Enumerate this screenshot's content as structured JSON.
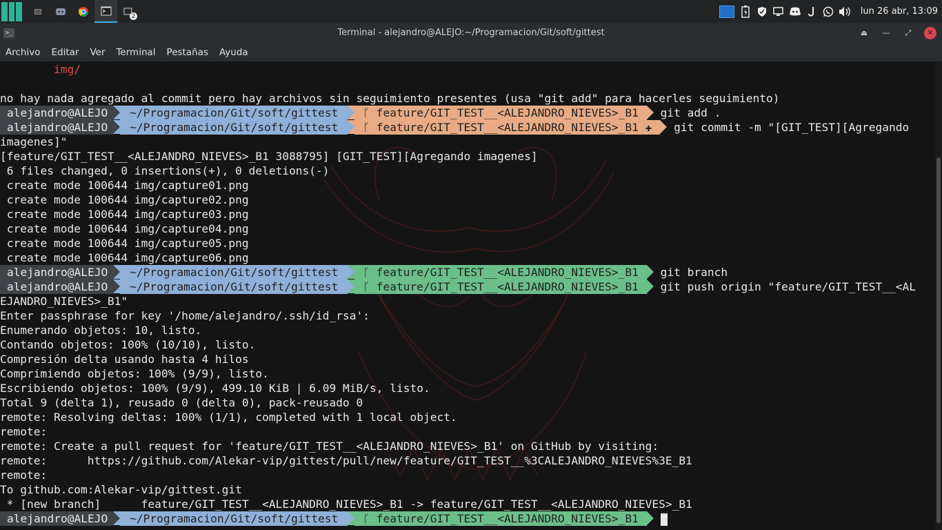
{
  "panel": {
    "tasks": [
      {
        "icon": "files-icon"
      },
      {
        "icon": "discord-icon"
      },
      {
        "icon": "chrome-icon"
      },
      {
        "icon": "terminal-icon"
      },
      {
        "icon": "windows-icon",
        "badge": "2"
      }
    ],
    "clock": "lun 26 abr, 13:09"
  },
  "window": {
    "title": "Terminal - alejandro@ALEJO:~/Programacion/Git/soft/gittest"
  },
  "menu": [
    "Archivo",
    "Editar",
    "Ver",
    "Terminal",
    "Pestañas",
    "Ayuda"
  ],
  "prompt": {
    "user": "alejandro@ALEJO",
    "path": "~/Programacion/Git/soft/gittest",
    "branch": "feature/GIT_TEST__<ALEJANDRO_NIEVES>_B1",
    "branch_glyph": "ᚴ"
  },
  "colors": {
    "user_bg": "#3e4348",
    "path_bg": "#8fb0d8",
    "git_dirty_bg": "#e8ab85",
    "git_clean_bg": "#6bbf8a",
    "error": "#e04646"
  },
  "terminal": {
    "lines": [
      {
        "text": "        img/",
        "color": "#e04646"
      },
      {
        "text": ""
      },
      {
        "text": "no hay nada agregado al commit pero hay archivos sin seguimiento presentes (usa \"git add\" para hacerles seguimiento)"
      },
      {
        "prompt": "dirty",
        "cmd": "git add ."
      },
      {
        "prompt": "dirty_plus",
        "cmd": "git commit -m \"[GIT_TEST][Agregando"
      },
      {
        "text": "imagenes]\""
      },
      {
        "text": "[feature/GIT_TEST__<ALEJANDRO_NIEVES>_B1 3088795] [GIT_TEST][Agregando imagenes]"
      },
      {
        "text": " 6 files changed, 0 insertions(+), 0 deletions(-)"
      },
      {
        "text": " create mode 100644 img/capture01.png"
      },
      {
        "text": " create mode 100644 img/capture02.png"
      },
      {
        "text": " create mode 100644 img/capture03.png"
      },
      {
        "text": " create mode 100644 img/capture04.png"
      },
      {
        "text": " create mode 100644 img/capture05.png"
      },
      {
        "text": " create mode 100644 img/capture06.png"
      },
      {
        "prompt": "clean",
        "cmd": "git branch"
      },
      {
        "prompt": "clean",
        "cmd": "git push origin \"feature/GIT_TEST__<AL"
      },
      {
        "text": "EJANDRO_NIEVES>_B1\""
      },
      {
        "text": "Enter passphrase for key '/home/alejandro/.ssh/id_rsa':"
      },
      {
        "text": "Enumerando objetos: 10, listo."
      },
      {
        "text": "Contando objetos: 100% (10/10), listo."
      },
      {
        "text": "Compresión delta usando hasta 4 hilos"
      },
      {
        "text": "Comprimiendo objetos: 100% (9/9), listo."
      },
      {
        "text": "Escribiendo objetos: 100% (9/9), 499.10 KiB | 6.09 MiB/s, listo."
      },
      {
        "text": "Total 9 (delta 1), reusado 0 (delta 0), pack-reusado 0"
      },
      {
        "text": "remote: Resolving deltas: 100% (1/1), completed with 1 local object."
      },
      {
        "text": "remote:"
      },
      {
        "text": "remote: Create a pull request for 'feature/GIT_TEST__<ALEJANDRO_NIEVES>_B1' on GitHub by visiting:"
      },
      {
        "text": "remote:      https://github.com/Alekar-vip/gittest/pull/new/feature/GIT_TEST__%3CALEJANDRO_NIEVES%3E_B1"
      },
      {
        "text": "remote:"
      },
      {
        "text": "To github.com:Alekar-vip/gittest.git"
      },
      {
        "text": " * [new branch]      feature/GIT_TEST__<ALEJANDRO_NIEVES>_B1 -> feature/GIT_TEST__<ALEJANDRO_NIEVES>_B1"
      },
      {
        "prompt": "clean",
        "cmd": "",
        "cursor": true
      }
    ]
  }
}
